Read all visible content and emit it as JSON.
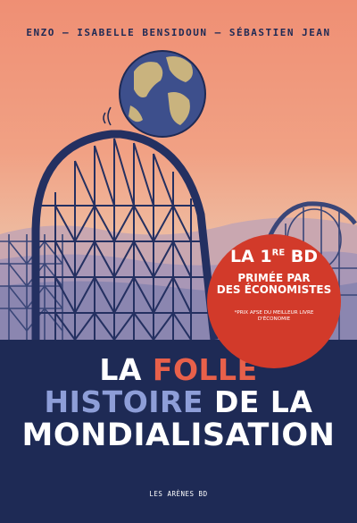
{
  "authors": "ENZO — ISABELLE BENSIDOUN — SÉBASTIEN JEAN",
  "title": {
    "line1_prefix": "LA ",
    "line1_highlight": "FOLLE",
    "line2_highlight": "HISTOIRE",
    "line2_suffix": " DE LA",
    "line3": "MONDIALISATION"
  },
  "badge": {
    "line1_prefix": "LA 1",
    "line1_sup": "RE",
    "line1_suffix": " BD",
    "line2": "PRIMÉE PAR",
    "line3": "DES ÉCONOMISTES",
    "note": "*PRIX AFSE DU MEILLEUR LIVRE D'ÉCONOMIE"
  },
  "publisher": "LES ARÈNES BD",
  "colors": {
    "sky_top": "#ef8f74",
    "navy": "#1e2a55",
    "accent_red": "#e8604a",
    "accent_blue": "#8e9ed8",
    "badge_red": "#d23a2a"
  }
}
